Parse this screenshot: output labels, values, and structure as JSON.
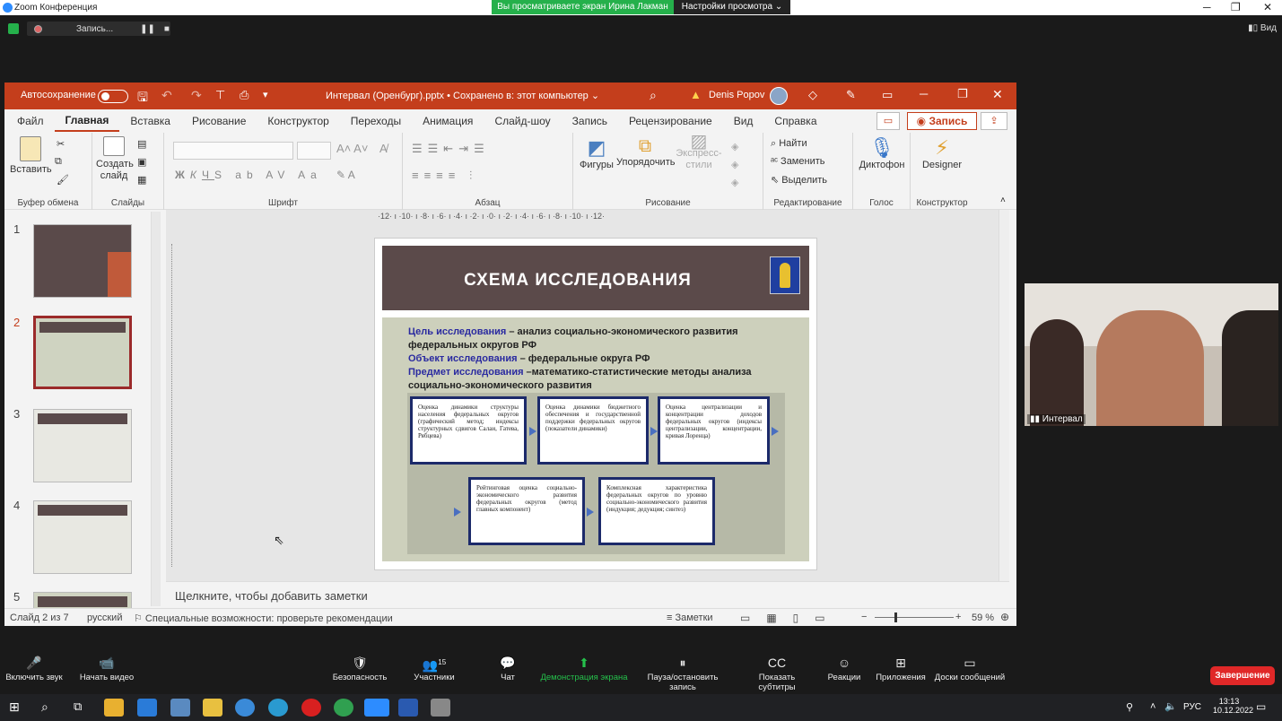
{
  "zoom": {
    "window_title": "Zoom Конференция",
    "banner": "Вы просматриваете экран Ирина Лакман",
    "view_settings": "Настройки просмотра ⌄",
    "recording": "Запись...",
    "view": "Вид"
  },
  "ppt": {
    "autosave": "Автосохранение",
    "title": "Интервал (Оренбург).pptx • Сохранено в: этот компьютер ⌄",
    "user": "Denis Popov",
    "tabs": [
      "Файл",
      "Главная",
      "Вставка",
      "Рисование",
      "Конструктор",
      "Переходы",
      "Анимация",
      "Слайд-шоу",
      "Запись",
      "Рецензирование",
      "Вид",
      "Справка"
    ],
    "record_btn": "Запись",
    "ribbon": {
      "paste": "Вставить",
      "new_slide": "Создать слайд",
      "shapes": "Фигуры",
      "arrange": "Упорядочить",
      "express": "Экспресс-стили",
      "find": "Найти",
      "replace": "Заменить",
      "select": "Выделить",
      "dictate": "Диктофон",
      "designer": "Designer",
      "groups": [
        "Буфер обмена",
        "Слайды",
        "Шрифт",
        "Абзац",
        "Рисование",
        "Редактирование",
        "Голос",
        "Конструктор"
      ]
    },
    "slide": {
      "title": "СХЕМА ИССЛЕДОВАНИЯ",
      "l1k": "Цель исследования",
      "l1v": " – анализ социально-экономического развития",
      "l1b": "федеральных округов РФ",
      "l2k": "Объект исследования",
      "l2v": " – федеральные округа РФ",
      "l3k": "Предмет исследования",
      "l3v": " –математико-статистические методы анализа",
      "l3b": "социально-экономического развития",
      "boxes": [
        "Оценка динамики структуры населения федеральных округов (графический метод; индексы структурных сдвигов Салаи, Гатева, Рябцева)",
        "Оценка динамики бюджетного обеспечения и государственной поддержки федеральных округов (показатели динамики)",
        "Оценка централизации и концентрации доходов федеральных округов (индексы централизации, концентрации, кривая Лоренца)",
        "Рейтинговая оценка социально-экономического развития федеральных округов (метод главных компонент)",
        "Комплексная характеристика федеральных округов по уровню социально-экономического развития (индукция; дедукция; синтез)"
      ]
    },
    "thumb_numbers": [
      "1",
      "2",
      "3",
      "4",
      "5"
    ],
    "thumb_titles": [
      "",
      "СХЕМА ИССЛЕДОВАНИЯ",
      "СТРУКТУРА НАСЕЛЕНИЯ РФ",
      "ПОКАЗАТЕЛИ ДИНАМИКИ БЮДЖЕТА",
      "ОЦЕНКА КОЭФФИЦИЕНТОВ"
    ],
    "notes": "Щелкните, чтобы добавить заметки",
    "status": {
      "slide": "Слайд 2 из 7",
      "lang": "русский",
      "access": "Специальные возможности: проверьте рекомендации",
      "notes": "Заметки",
      "zoom": "59 %"
    },
    "ruler": "·12· ı ·10· ı ·8· ı ·6· ı ·4· ı ·2· ı ·0· ı ·2· ı ·4· ı ·6· ı ·8· ı ·10· ı ·12·"
  },
  "cam": {
    "name": "Интервал"
  },
  "toolbar": [
    {
      "label": "Включить звук",
      "icon": "🎤"
    },
    {
      "label": "Начать видео",
      "icon": "📹"
    },
    {
      "label": "Безопасность",
      "icon": "🛡"
    },
    {
      "label": "Участники",
      "icon": "👥",
      "count": "15"
    },
    {
      "label": "Чат",
      "icon": "💬"
    },
    {
      "label": "Демонстрация экрана",
      "icon": "⬆"
    },
    {
      "label": "Пауза/остановить запись",
      "icon": "⏸"
    },
    {
      "label": "Показать субтитры",
      "icon": "CC"
    },
    {
      "label": "Реакции",
      "icon": "☺"
    },
    {
      "label": "Приложения",
      "icon": "⊞"
    },
    {
      "label": "Доски сообщений",
      "icon": "▭"
    }
  ],
  "end": "Завершение",
  "taskbar": {
    "lang": "РУС",
    "time": "13:13",
    "date": "10.12.2022"
  }
}
